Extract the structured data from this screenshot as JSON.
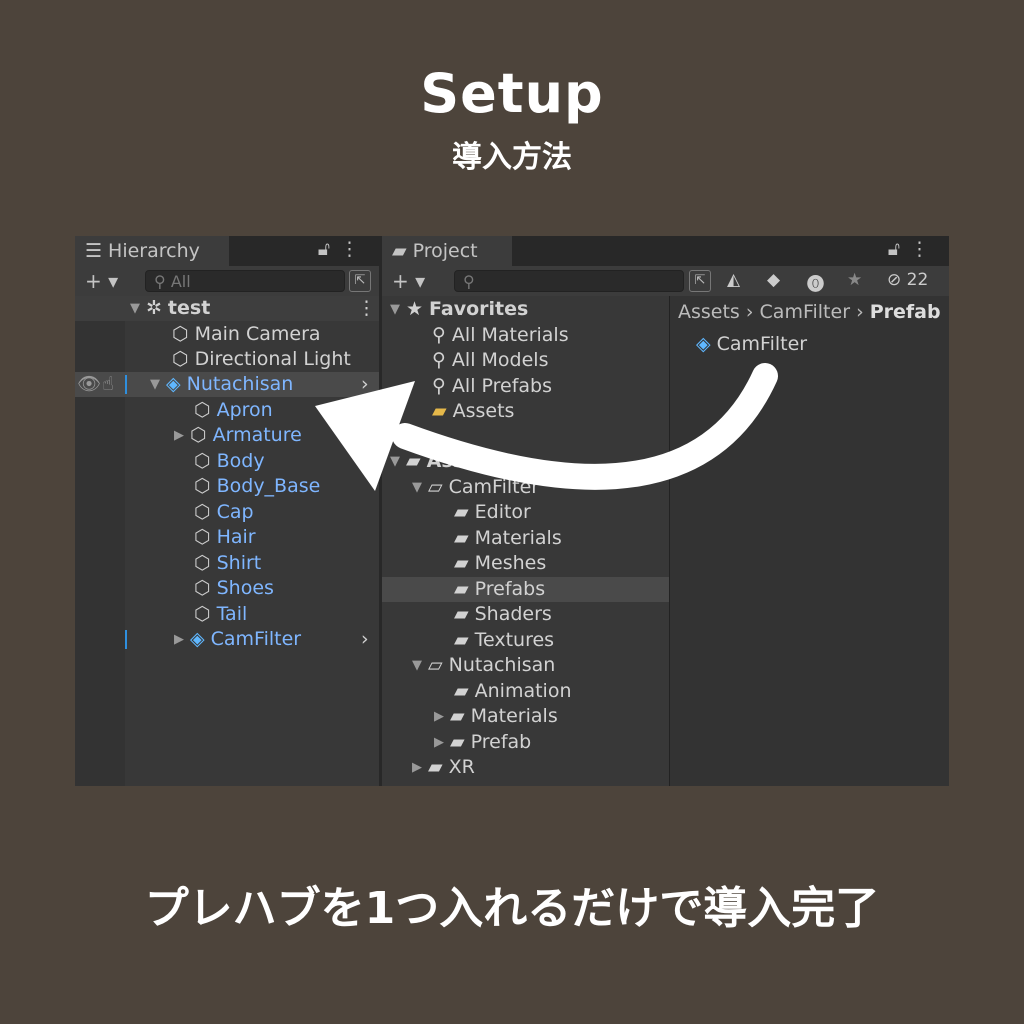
{
  "header": {
    "title": "Setup",
    "subtitle": "導入方法"
  },
  "caption": "プレハブを1つ入れるだけで導入完了",
  "hierarchy": {
    "tab_label": "Hierarchy",
    "search_placeholder": "All",
    "root": "test",
    "items": [
      {
        "label": "Main Camera"
      },
      {
        "label": "Directional Light"
      },
      {
        "label": "Nutachisan"
      },
      {
        "label": "Apron"
      },
      {
        "label": "Armature"
      },
      {
        "label": "Body"
      },
      {
        "label": "Body_Base"
      },
      {
        "label": "Cap"
      },
      {
        "label": "Hair"
      },
      {
        "label": "Shirt"
      },
      {
        "label": "Shoes"
      },
      {
        "label": "Tail"
      },
      {
        "label": "CamFilter"
      }
    ]
  },
  "project": {
    "tab_label": "Project",
    "hidden_count": "22",
    "favorites": {
      "label": "Favorites",
      "items": [
        "All Materials",
        "All Models",
        "All Prefabs",
        "Assets"
      ]
    },
    "assets_label": "Assets",
    "camfilter_folder": "CamFilter",
    "camfilter_children": [
      "Editor",
      "Materials",
      "Meshes",
      "Prefabs",
      "Shaders",
      "Textures"
    ],
    "nutachisan_folder": "Nutachisan",
    "nutachisan_children": [
      "Animation",
      "Materials",
      "Prefab"
    ],
    "xr_folder": "XR",
    "breadcrumb": [
      "Assets",
      "CamFilter",
      "Prefab"
    ],
    "content_items": [
      "CamFilter"
    ]
  },
  "colors": {
    "accent_blue": "#7fb6ff",
    "background": "#4d443b",
    "panel": "#383838"
  }
}
